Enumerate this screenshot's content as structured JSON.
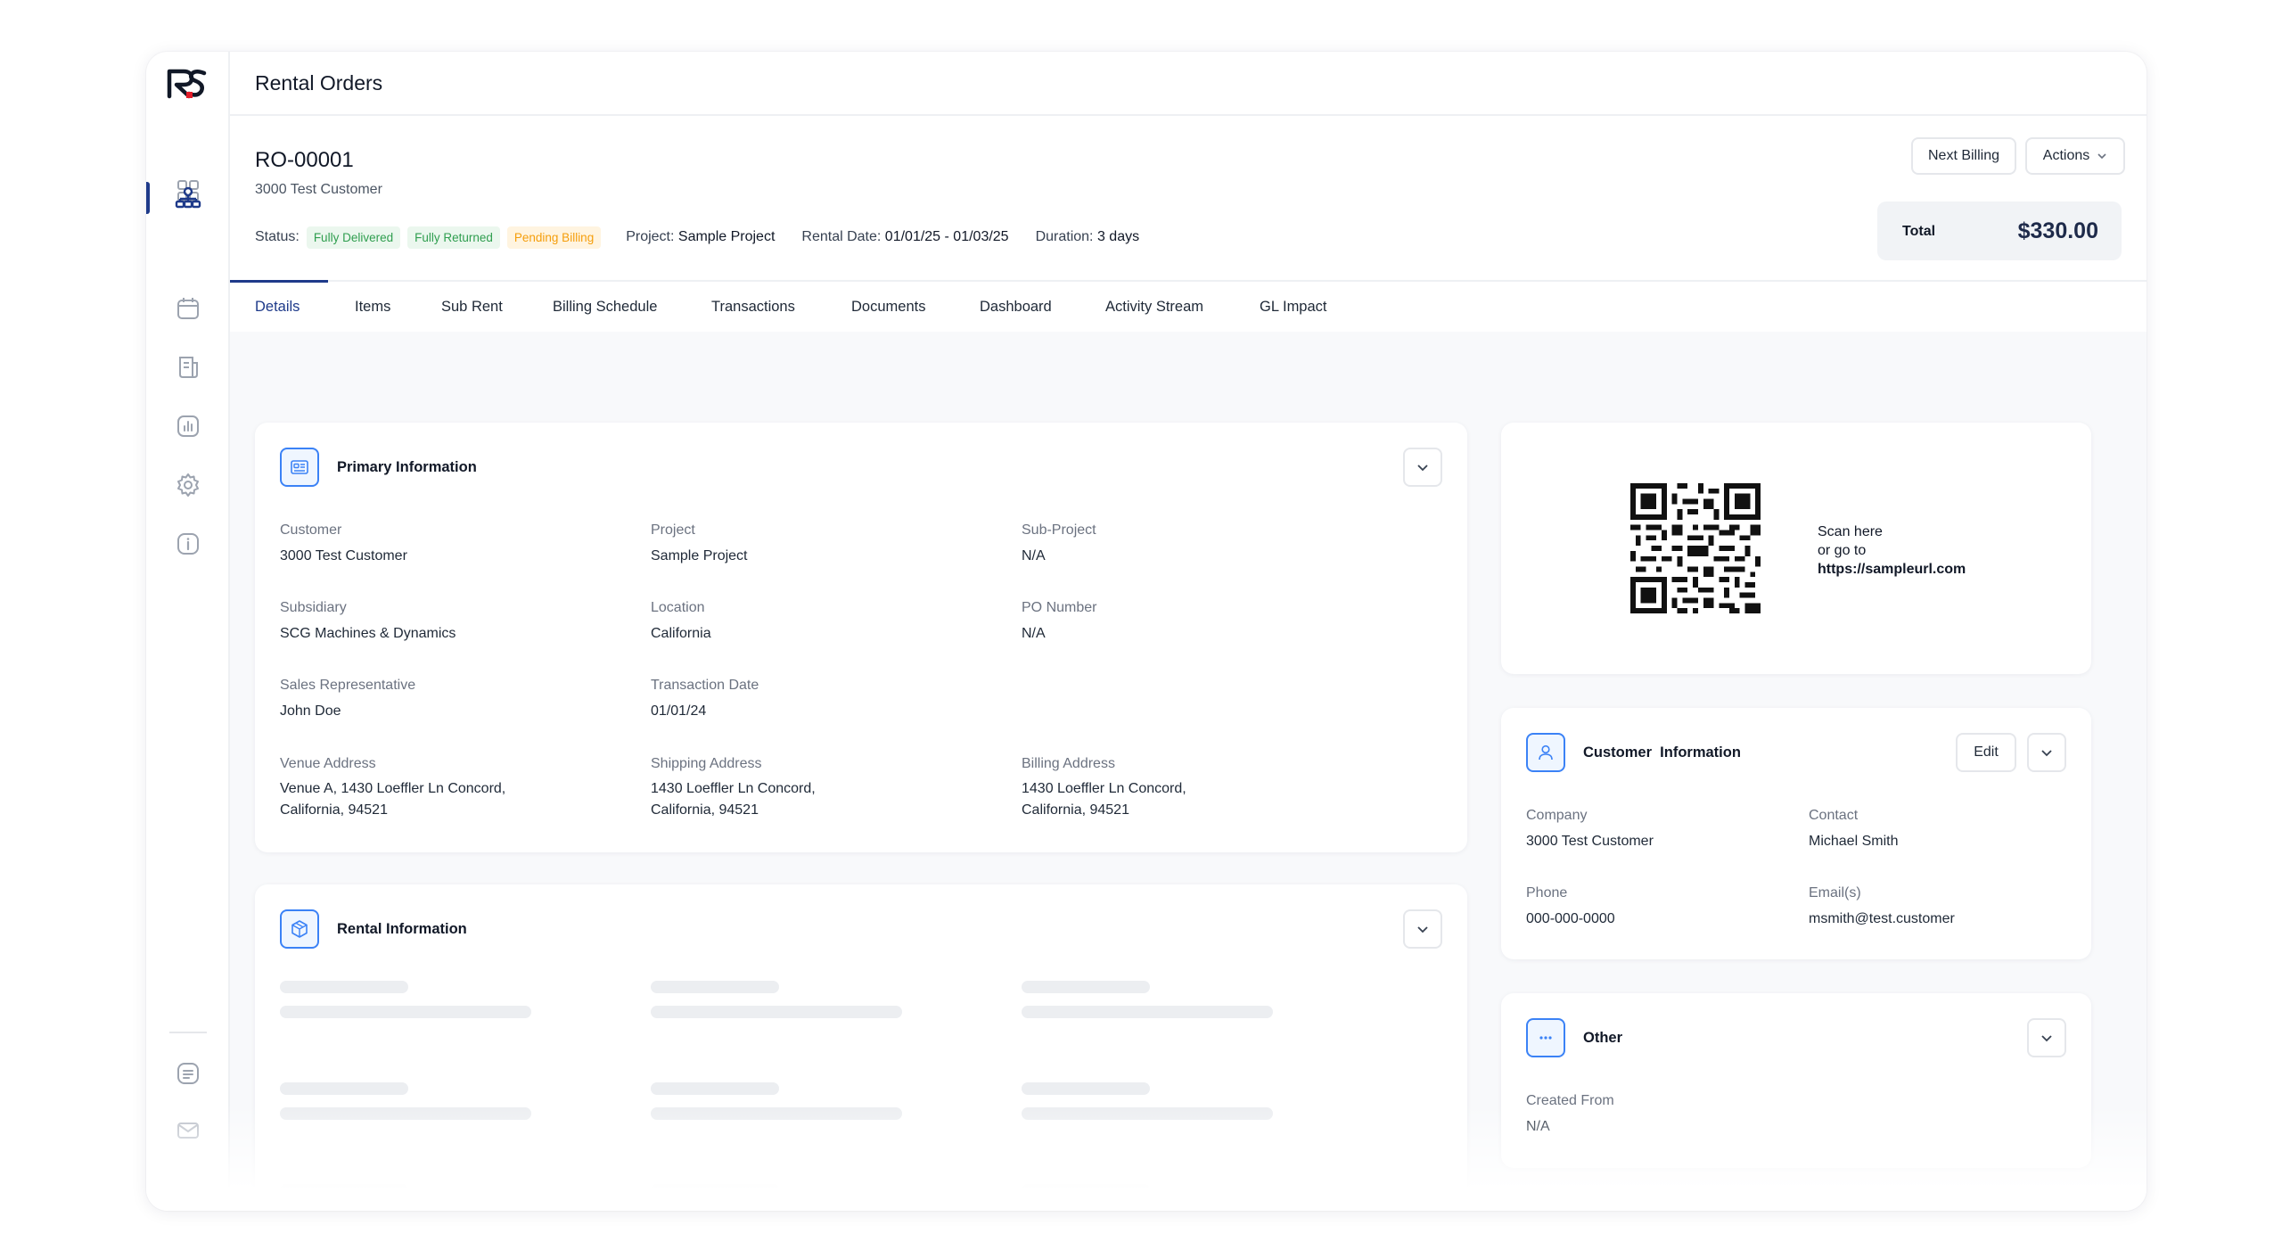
{
  "app": {
    "page_title": "Rental Orders"
  },
  "order": {
    "id": "RO-00001",
    "customer": "3000 Test Customer",
    "status_label": "Status:",
    "badges": [
      "Fully Delivered",
      "Fully Returned",
      "Pending Billing"
    ],
    "project_label": "Project:",
    "project_value": "Sample Project",
    "rental_date_label": "Rental Date:",
    "rental_date_value": "01/01/25 - 01/03/25",
    "duration_label": "Duration:",
    "duration_value": "3 days"
  },
  "header_actions": {
    "next_billing": "Next Billing",
    "actions": "Actions"
  },
  "total": {
    "label": "Total",
    "value": "$330.00"
  },
  "tabs": [
    "Details",
    "Items",
    "Sub Rent",
    "Billing Schedule",
    "Transactions",
    "Documents",
    "Dashboard",
    "Activity Stream",
    "GL Impact"
  ],
  "primary": {
    "title": "Primary Information",
    "fields": [
      {
        "label": "Customer",
        "value": "3000 Test Customer"
      },
      {
        "label": "Project",
        "value": "Sample Project"
      },
      {
        "label": "Sub-Project",
        "value": "N/A"
      },
      {
        "label": "Subsidiary",
        "value": "SCG Machines & Dynamics"
      },
      {
        "label": "Location",
        "value": "California"
      },
      {
        "label": "PO Number",
        "value": "N/A"
      },
      {
        "label": "Sales Representative",
        "value": "John Doe"
      },
      {
        "label": "Transaction Date",
        "value": "01/01/24"
      },
      {
        "label": "Venue Address",
        "value": "Venue A, 1430 Loeffler Ln Concord,",
        "value2": "California, 94521"
      },
      {
        "label": "Shipping Address",
        "value": "1430 Loeffler Ln Concord,",
        "value2": "California, 94521"
      },
      {
        "label": "Billing Address",
        "value": "1430 Loeffler Ln Concord,",
        "value2": "California, 94521"
      }
    ]
  },
  "rental": {
    "title": "Rental Information"
  },
  "qr": {
    "line1": "Scan here",
    "line2": "or go to",
    "url": "https://sampleurl.com"
  },
  "customer_info": {
    "title": "Customer  Information",
    "edit_label": "Edit",
    "fields": [
      {
        "label": "Company",
        "value": "3000 Test Customer"
      },
      {
        "label": "Contact",
        "value": "Michael Smith"
      },
      {
        "label": "Phone",
        "value": "000-000-0000"
      },
      {
        "label": "Email(s)",
        "value": "msmith@test.customer"
      }
    ]
  },
  "other": {
    "title": "Other",
    "fields": [
      {
        "label": "Created From",
        "value": "N/A"
      }
    ]
  },
  "colors": {
    "accent": "#1e3a8a",
    "icon_blue": "#3b82f6",
    "badge_green": "#2f9e4f",
    "badge_orange": "#f59e0b"
  },
  "icons": {
    "sidebar": [
      "dashboard-grid-icon",
      "sitemap-icon",
      "calendar-icon",
      "document-icon",
      "report-chart-icon",
      "gear-icon",
      "info-icon",
      "chat-icon",
      "mail-icon"
    ],
    "cards": [
      "id-card-icon",
      "package-icon",
      "user-icon",
      "more-dots-icon"
    ]
  }
}
